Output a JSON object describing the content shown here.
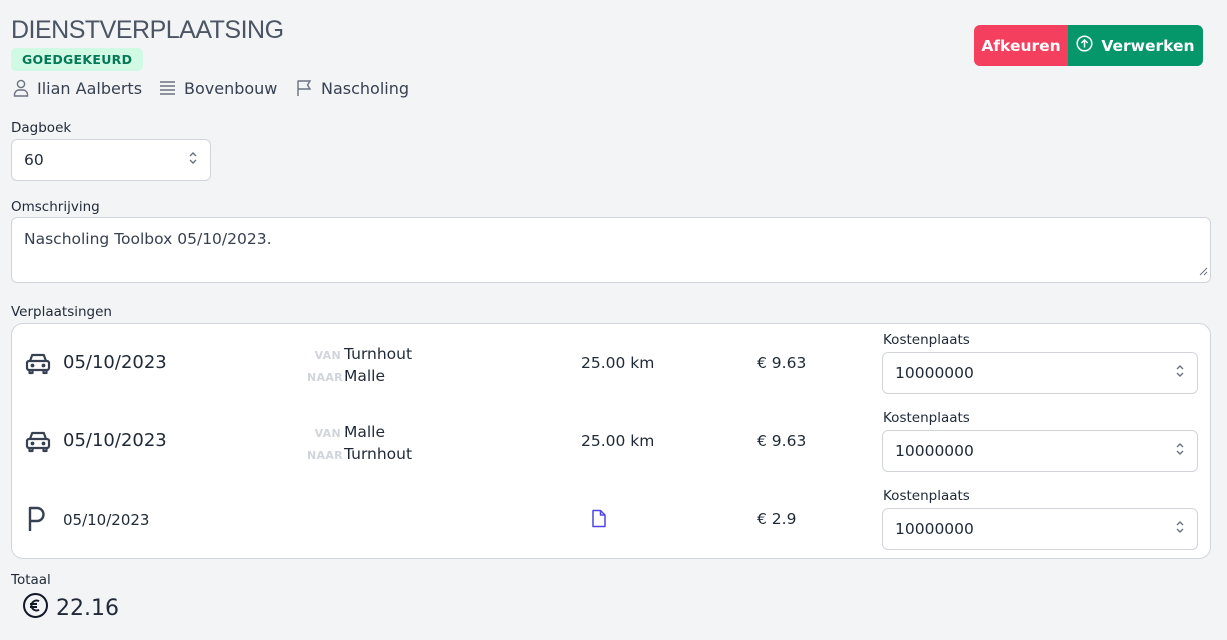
{
  "header": {
    "title": "DIENSTVERPLAATSING",
    "status_badge": "GOEDGEKEURD",
    "meta": {
      "person": "Ilian Aalberts",
      "department": "Bovenbouw",
      "category": "Nascholing"
    },
    "actions": {
      "reject_label": "Afkeuren",
      "process_label": "Verwerken"
    }
  },
  "form": {
    "dagboek_label": "Dagboek",
    "dagboek_value": "60",
    "omschrijving_label": "Omschrijving",
    "omschrijving_value": "Nascholing Toolbox 05/10/2023."
  },
  "trips": {
    "section_label": "Verplaatsingen",
    "from_tag": "VAN",
    "to_tag": "NAAR",
    "cost_center_label": "Kostenplaats",
    "items": [
      {
        "type": "car-icon",
        "date": "05/10/2023",
        "from": "Turnhout",
        "to": "Malle",
        "distance": "25.00 km",
        "amount": "€ 9.63",
        "cost_center": "10000000"
      },
      {
        "type": "car-icon",
        "date": "05/10/2023",
        "from": "Malle",
        "to": "Turnhout",
        "distance": "25.00 km",
        "amount": "€ 9.63",
        "cost_center": "10000000"
      },
      {
        "type": "parking-icon",
        "date": "05/10/2023",
        "attachment": "document-icon",
        "amount": "€ 2.9",
        "cost_center": "10000000"
      }
    ]
  },
  "total": {
    "label": "Totaal",
    "value": "22.16"
  },
  "colors": {
    "reject": "#f43f5e",
    "process": "#059669",
    "badge_bg": "#d1fae5",
    "badge_text": "#047857",
    "attachment": "#4f46e5"
  }
}
